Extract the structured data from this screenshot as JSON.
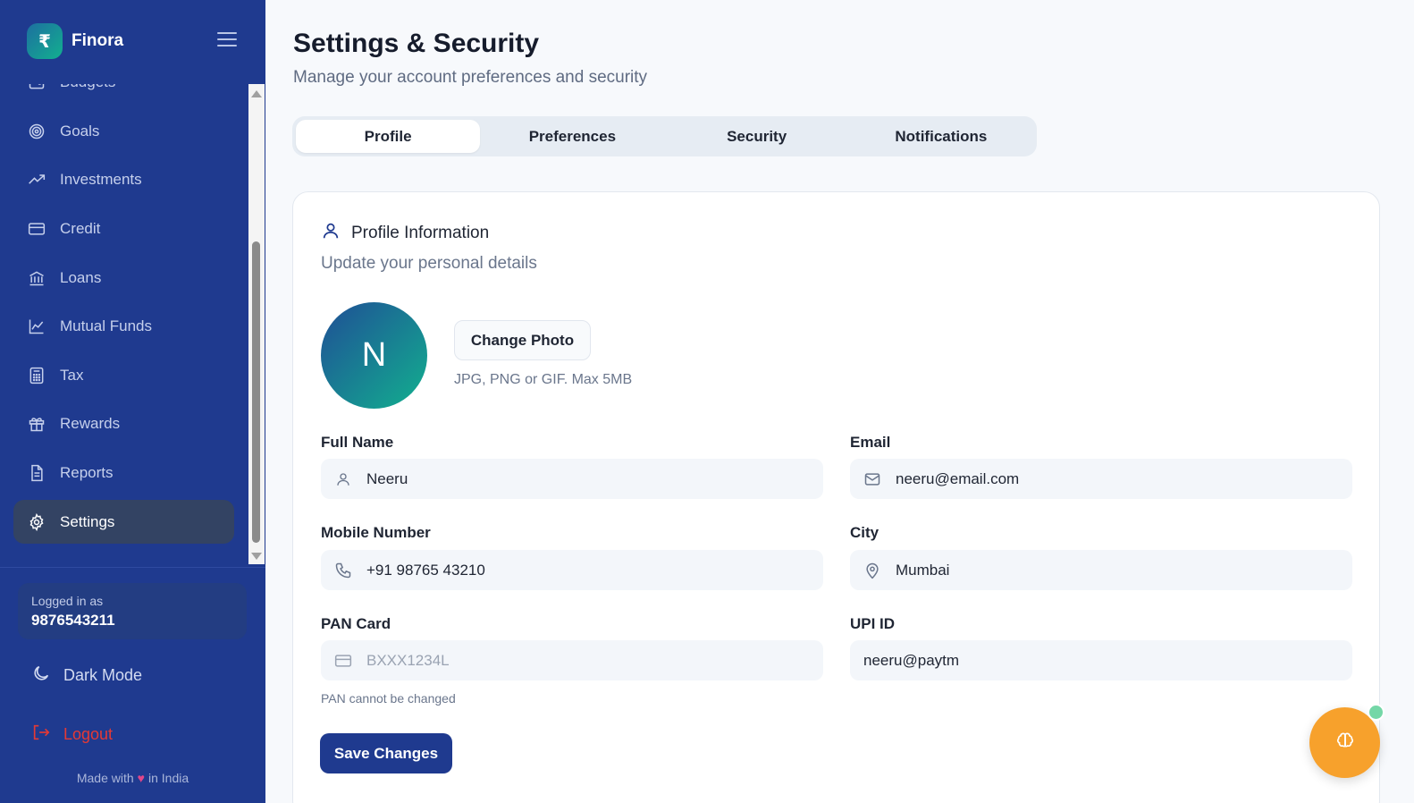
{
  "brand": {
    "logo_symbol": "₹",
    "name": "Finora"
  },
  "sidebar": {
    "items": [
      {
        "label": "Budgets",
        "icon": "wallet-icon"
      },
      {
        "label": "Goals",
        "icon": "target-icon"
      },
      {
        "label": "Investments",
        "icon": "trending-up-icon"
      },
      {
        "label": "Credit",
        "icon": "credit-card-icon"
      },
      {
        "label": "Loans",
        "icon": "bank-icon"
      },
      {
        "label": "Mutual Funds",
        "icon": "line-chart-icon"
      },
      {
        "label": "Tax",
        "icon": "calculator-icon"
      },
      {
        "label": "Rewards",
        "icon": "gift-icon"
      },
      {
        "label": "Reports",
        "icon": "document-icon"
      },
      {
        "label": "Settings",
        "icon": "gear-icon",
        "active": true
      }
    ],
    "logged_in_label": "Logged in as",
    "logged_in_user": "9876543211",
    "dark_mode_label": "Dark Mode",
    "logout_label": "Logout",
    "footer": {
      "prefix": "Made with",
      "heart": "♥",
      "suffix": "in India"
    }
  },
  "page": {
    "title": "Settings & Security",
    "subtitle": "Manage your account preferences and security"
  },
  "tabs": [
    {
      "label": "Profile",
      "active": true
    },
    {
      "label": "Preferences",
      "active": false
    },
    {
      "label": "Security",
      "active": false
    },
    {
      "label": "Notifications",
      "active": false
    }
  ],
  "profile": {
    "header": "Profile Information",
    "subtitle": "Update your personal details",
    "avatar_initial": "N",
    "change_photo_label": "Change Photo",
    "photo_hint": "JPG, PNG or GIF. Max 5MB",
    "fields": {
      "full_name": {
        "label": "Full Name",
        "value": "Neeru"
      },
      "email": {
        "label": "Email",
        "value": "neeru@email.com"
      },
      "mobile": {
        "label": "Mobile Number",
        "value": "+91 98765 43210"
      },
      "city": {
        "label": "City",
        "value": "Mumbai"
      },
      "pan": {
        "label": "PAN Card",
        "value": "BXXX1234L",
        "hint": "PAN cannot be changed"
      },
      "upi": {
        "label": "UPI ID",
        "value": "neeru@paytm"
      }
    },
    "save_label": "Save Changes"
  },
  "colors": {
    "sidebar_bg": "#1f3a8f",
    "primary": "#1f3a8f",
    "logout": "#e53935",
    "fab": "#f7a12c",
    "online_dot": "#74d7a7"
  }
}
